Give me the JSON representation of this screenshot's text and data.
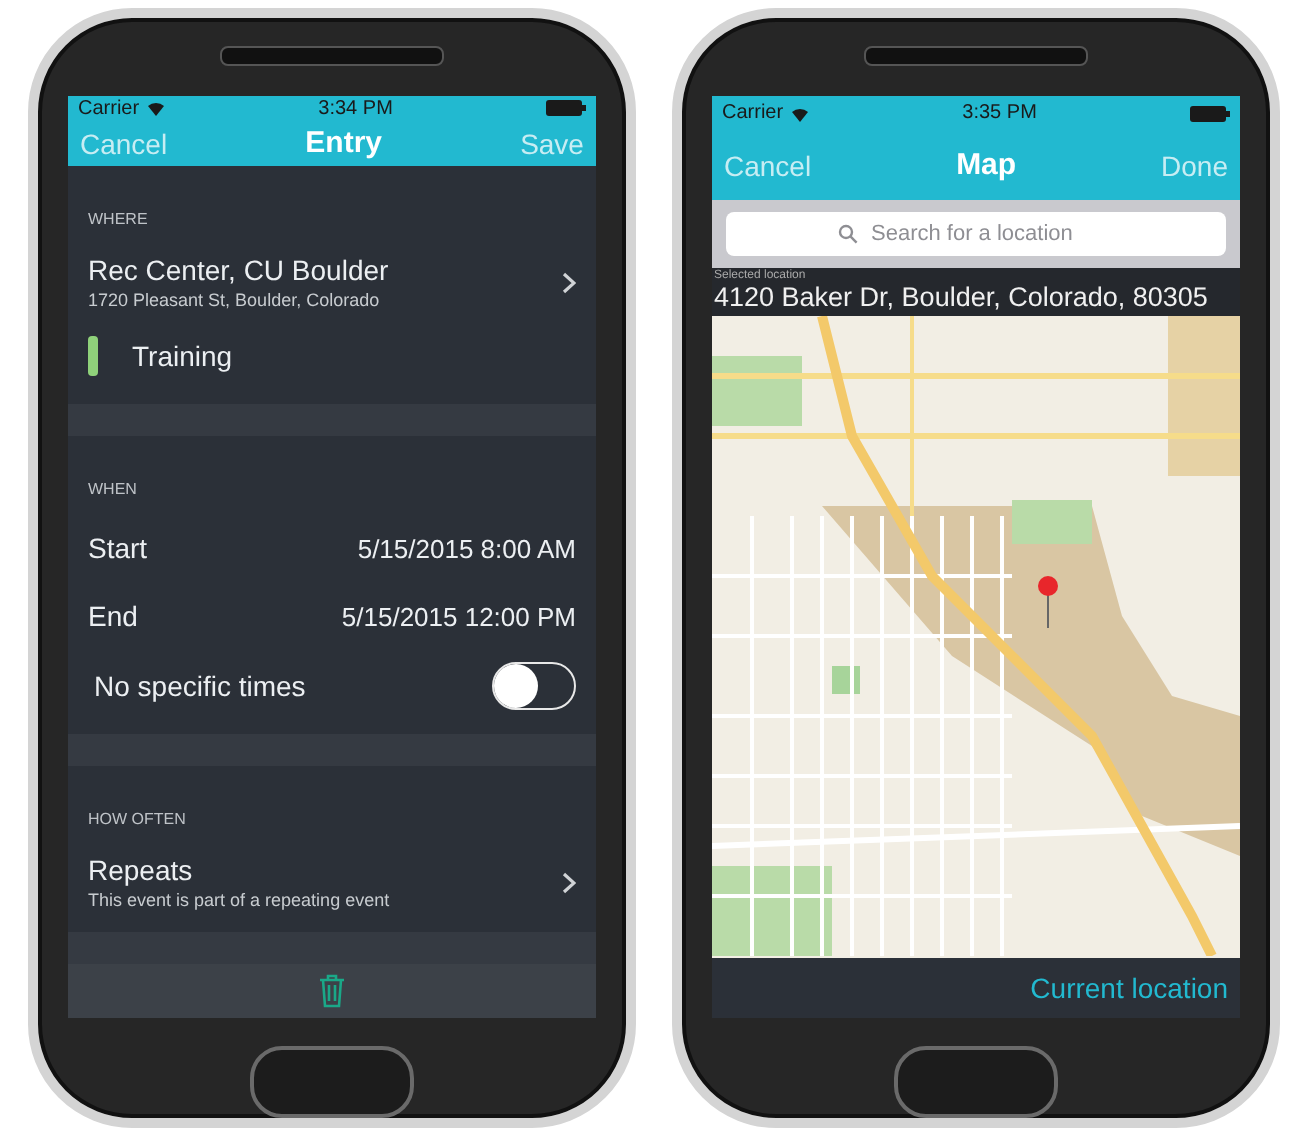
{
  "entry_screen": {
    "status_bar": {
      "carrier": "Carrier",
      "time": "3:34 PM"
    },
    "nav": {
      "left": "Cancel",
      "title": "Entry",
      "right": "Save"
    },
    "sections": [
      {
        "header": "WHERE",
        "rows": [
          {
            "kind": "detail",
            "title": "Rec Center, CU Boulder",
            "subtitle": "1720 Pleasant St, Boulder, Colorado"
          },
          {
            "kind": "tag",
            "label": "Training",
            "color": "#8fd17a"
          }
        ]
      },
      {
        "header": "WHEN",
        "rows": [
          {
            "kind": "value",
            "label": "Start",
            "value": "5/15/2015 8:00 AM"
          },
          {
            "kind": "value",
            "label": "End",
            "value": "5/15/2015 12:00 PM"
          },
          {
            "kind": "switch",
            "label": "No specific times",
            "on": false
          }
        ]
      },
      {
        "header": "HOW OFTEN",
        "rows": [
          {
            "kind": "detail",
            "title": "Repeats",
            "subtitle": "This event is part of a repeating event"
          }
        ]
      }
    ]
  },
  "map_screen": {
    "status_bar": {
      "carrier": "Carrier",
      "time": "3:35 PM"
    },
    "nav": {
      "left": "Cancel",
      "title": "Map",
      "right": "Done"
    },
    "search": {
      "placeholder": "Search for a location"
    },
    "selected_location": {
      "caption": "Selected location",
      "address": "4120 Baker Dr, Boulder, Colorado, 80305"
    },
    "footer": {
      "button": "Current location"
    }
  }
}
